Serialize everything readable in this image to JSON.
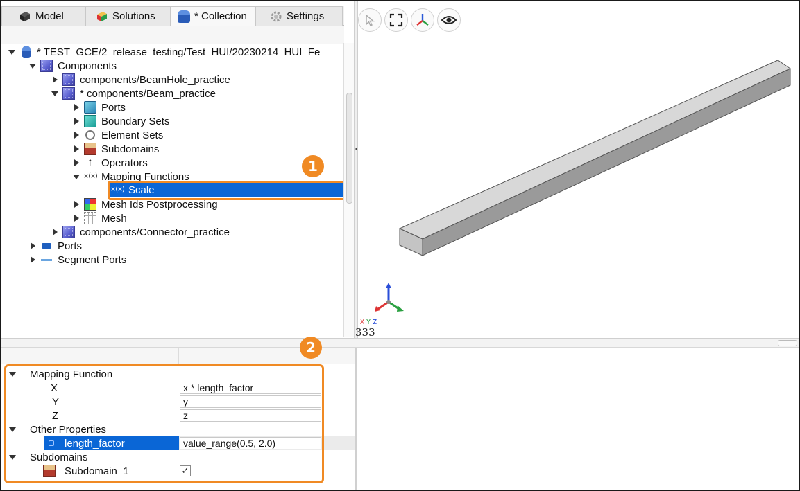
{
  "tabs": [
    {
      "label": "Model",
      "icon": "model-icon"
    },
    {
      "label": "Solutions",
      "icon": "solutions-icon"
    },
    {
      "label": "* Collection",
      "icon": "collection-icon"
    },
    {
      "label": "Settings",
      "icon": "settings-icon"
    }
  ],
  "tree": {
    "root": "* TEST_GCE/2_release_testing/Test_HUI/20230214_HUI_Fe",
    "components": "Components",
    "beamhole": "components/BeamHole_practice",
    "beam": "* components/Beam_practice",
    "ports": "Ports",
    "boundary_sets": "Boundary Sets",
    "element_sets": "Element Sets",
    "subdomains": "Subdomains",
    "operators": "Operators",
    "mapping_functions": "Mapping Functions",
    "scale": "Scale",
    "mesh_ids": "Mesh Ids Postprocessing",
    "mesh": "Mesh",
    "connector": "components/Connector_practice",
    "root_ports": "Ports",
    "segment_ports": "Segment Ports"
  },
  "badges": {
    "one": "1",
    "two": "2"
  },
  "viewport": {
    "buttons": [
      "select-icon",
      "fit-view-icon",
      "axes-icon",
      "visibility-icon"
    ],
    "triad_labels": {
      "x": "X",
      "y": "Y",
      "z": "Z"
    },
    "scale": "333"
  },
  "properties": {
    "mapping_function": "Mapping Function",
    "x_label": "X",
    "x_value": "x * length_factor",
    "y_label": "Y",
    "y_value": "y",
    "z_label": "Z",
    "z_value": "z",
    "other_properties": "Other Properties",
    "length_factor_label": "length_factor",
    "length_factor_value": "value_range(0.5, 2.0)",
    "subdomains": "Subdomains",
    "subdomain_1": "Subdomain_1",
    "subdomain_1_checked": "✓"
  },
  "colors": {
    "accent": "#f08a24",
    "selection": "#0a66d6"
  }
}
